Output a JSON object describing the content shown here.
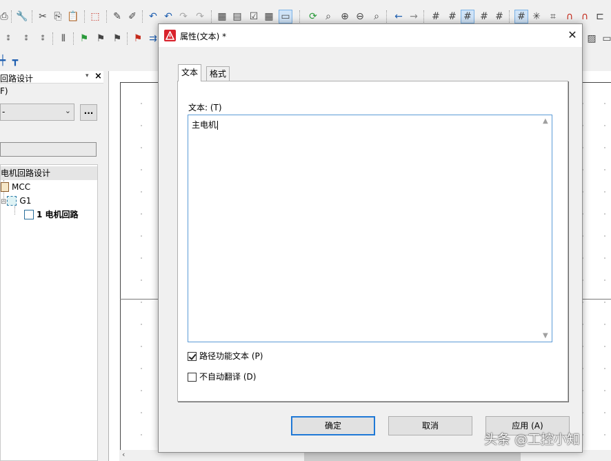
{
  "background": {
    "left_panel": {
      "title": "回路设计",
      "filter_label": "F)",
      "filter_select_value": "-",
      "browse_button": "...",
      "tree": [
        {
          "label": "电机回路设计",
          "bold": false
        },
        {
          "label": "MCC",
          "bold": false
        },
        {
          "label": "G1",
          "bold": false
        },
        {
          "label": "1 电机回路",
          "bold": true
        }
      ]
    }
  },
  "dialog": {
    "title": "属性(文本) *",
    "tabs": [
      {
        "label": "文本",
        "active": true
      },
      {
        "label": "格式",
        "active": false
      }
    ],
    "text_field": {
      "label": "文本: (T)",
      "value": "主电机"
    },
    "options": [
      {
        "label": "路径功能文本 (P)",
        "checked": true
      },
      {
        "label": "不自动翻译 (D)",
        "checked": false
      }
    ],
    "buttons": {
      "ok": "确定",
      "cancel": "取消",
      "apply": "应用 (A)"
    }
  },
  "watermark": "头条 @工控小知",
  "colors": {
    "accent": "#1e78d6",
    "logo": "#d9232d"
  }
}
